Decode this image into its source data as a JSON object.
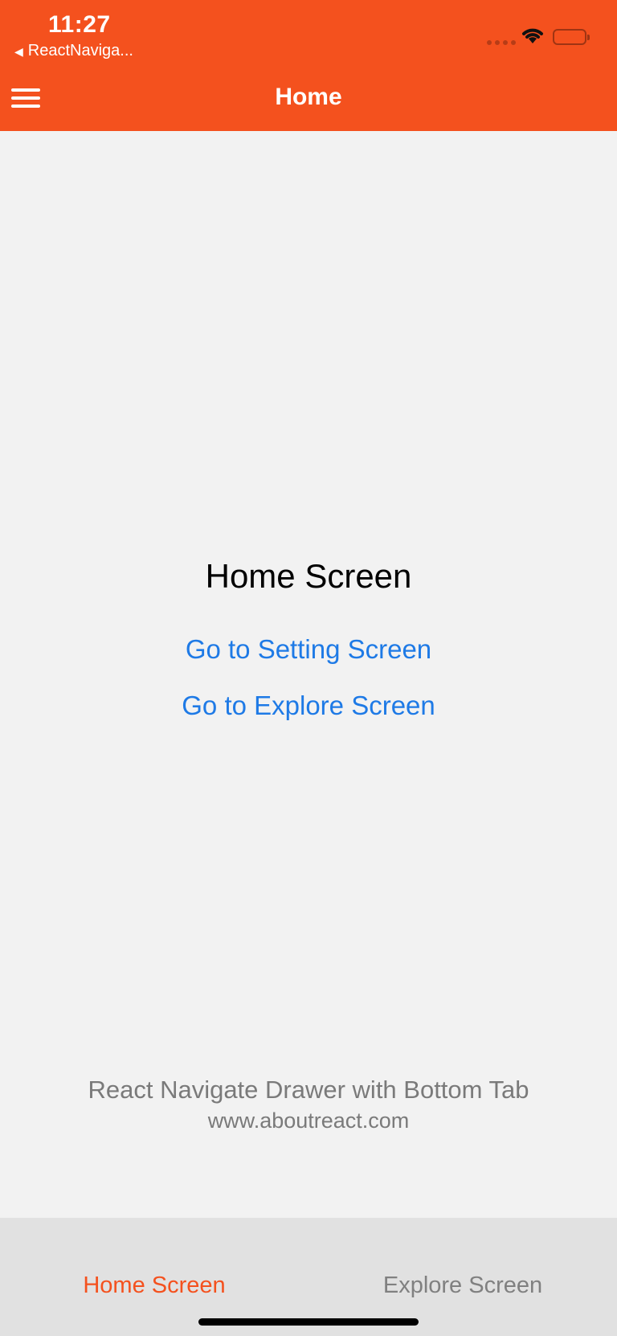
{
  "status_bar": {
    "time": "11:27",
    "back_app": "ReactNaviga...",
    "back_icon": "back-triangle-icon",
    "signal_icon": "cellular-signal-icon",
    "wifi_icon": "wifi-icon",
    "battery_icon": "battery-icon"
  },
  "header": {
    "title": "Home",
    "menu_icon": "hamburger-menu-icon",
    "background": "#f4511e"
  },
  "main": {
    "screen_title": "Home Screen",
    "links": [
      {
        "label": "Go to Setting Screen"
      },
      {
        "label": "Go to Explore Screen"
      }
    ],
    "link_color": "#1e7ae6",
    "footer_line1": "React Navigate Drawer with Bottom Tab",
    "footer_line2": "www.aboutreact.com"
  },
  "tabbar": {
    "tabs": [
      {
        "label": "Home Screen",
        "active": true
      },
      {
        "label": "Explore Screen",
        "active": false
      }
    ],
    "active_color": "#f4511e",
    "inactive_color": "#808080"
  }
}
